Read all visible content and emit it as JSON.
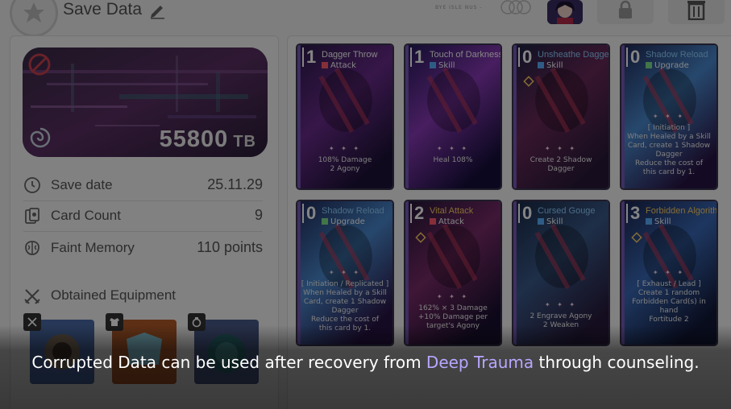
{
  "header": {
    "title": "Save Data",
    "deco_text": "BYE ISLE NUS -"
  },
  "data_card": {
    "storage_value": "55800",
    "storage_unit": "TB"
  },
  "stats": [
    {
      "label": "Save date",
      "value": "25.11.29"
    },
    {
      "label": "Card Count",
      "value": "9"
    },
    {
      "label": "Faint Memory",
      "value": "110 points"
    }
  ],
  "equipment": {
    "label": "Obtained Equipment",
    "stars": "★★★★★"
  },
  "cards": [
    {
      "cost": "1",
      "name": "Dagger Throw",
      "type": "Attack",
      "type_color": "#ff5a6e",
      "name_color": "#ffffff",
      "desc": [
        "108% Damage",
        "2 Agony"
      ],
      "has_mark": false
    },
    {
      "cost": "1",
      "name": "Touch of Darkness",
      "type": "Skill",
      "type_color": "#5ab0ff",
      "name_color": "#ffffff",
      "desc": [
        "Heal 108%"
      ],
      "has_mark": false
    },
    {
      "cost": "0",
      "name": "Unsheathe Dagger",
      "type": "Skill",
      "type_color": "#5ab0ff",
      "name_color": "#8fd0ff",
      "desc": [
        "Create 2 Shadow",
        "Dagger"
      ],
      "has_mark": true
    },
    {
      "cost": "0",
      "name": "Shadow Reload",
      "type": "Upgrade",
      "type_color": "#7fe08a",
      "name_color": "#8fd0ff",
      "desc": [
        "[ Initiation ]",
        "When Healed by a Skill",
        "Card, create 1 Shadow",
        "Dagger",
        "Reduce the cost of",
        "this card by 1."
      ],
      "has_mark": false
    },
    {
      "cost": "0",
      "name": "Shadow Reload",
      "type": "Upgrade",
      "type_color": "#7fe08a",
      "name_color": "#8fd0ff",
      "desc": [
        "[ Initiation / Replicated ]",
        "When Healed by a Skill",
        "Card, create 1 Shadow",
        "Dagger",
        "Reduce the cost of",
        "this card by 1."
      ],
      "has_mark": false
    },
    {
      "cost": "2",
      "name": "Vital Attack",
      "type": "Attack",
      "type_color": "#ff5a6e",
      "name_color": "#ffd166",
      "desc": [
        "162% × 3 Damage",
        "+10% Damage per",
        "target's Agony"
      ],
      "has_mark": true
    },
    {
      "cost": "0",
      "name": "Cursed Gouge",
      "type": "Skill",
      "type_color": "#5ab0ff",
      "name_color": "#8fd0ff",
      "desc": [
        "2 Engrave Agony",
        "2 Weaken"
      ],
      "has_mark": false
    },
    {
      "cost": "3",
      "name": "Forbidden Algorithm",
      "type": "Skill",
      "type_color": "#5ab0ff",
      "name_color": "#ffd166",
      "desc": [
        "[ Exhaust / Lead ]",
        "Create 1 random",
        "Forbidden Card(s) in",
        "hand",
        "Fortitude 2"
      ],
      "has_mark": true
    }
  ],
  "caption": {
    "before": "Corrupted Data can be used after recovery from ",
    "keyword": "Deep Trauma",
    "after": " through counseling."
  },
  "colors": {
    "keyword": "#b9a6ff",
    "attack": "#ff5a6e",
    "skill": "#5ab0ff",
    "upgrade": "#7fe08a"
  }
}
